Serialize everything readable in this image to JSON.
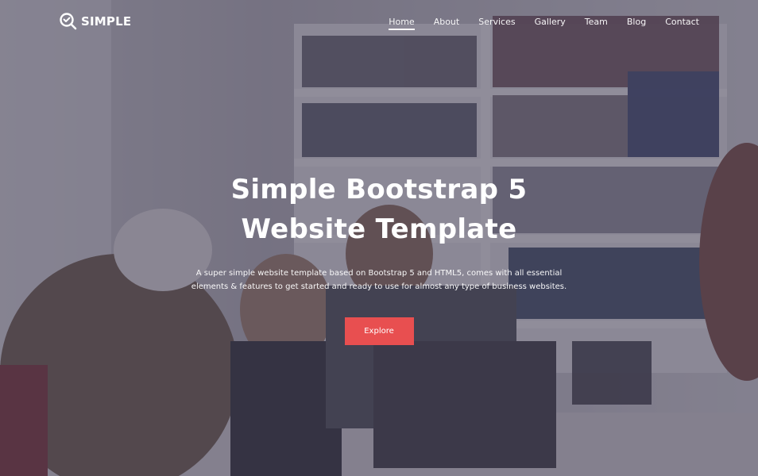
{
  "brand": {
    "name": "SIMPLE"
  },
  "nav": {
    "items": [
      {
        "label": "Home",
        "active": true
      },
      {
        "label": "About",
        "active": false
      },
      {
        "label": "Services",
        "active": false
      },
      {
        "label": "Gallery",
        "active": false
      },
      {
        "label": "Team",
        "active": false
      },
      {
        "label": "Blog",
        "active": false
      },
      {
        "label": "Contact",
        "active": false
      }
    ]
  },
  "hero": {
    "headline_line1": "Simple Bootstrap 5",
    "headline_line2": "Website Template",
    "subtext_line1": "A super simple website template based on Bootstrap 5 and HTML5, comes with all essential",
    "subtext_line2": "elements & features to get started and ready to use for almost any type of business websites.",
    "cta_label": "Explore"
  },
  "colors": {
    "overlay": "#3e3a50",
    "accent": "#e84f50",
    "text": "#ffffff"
  }
}
